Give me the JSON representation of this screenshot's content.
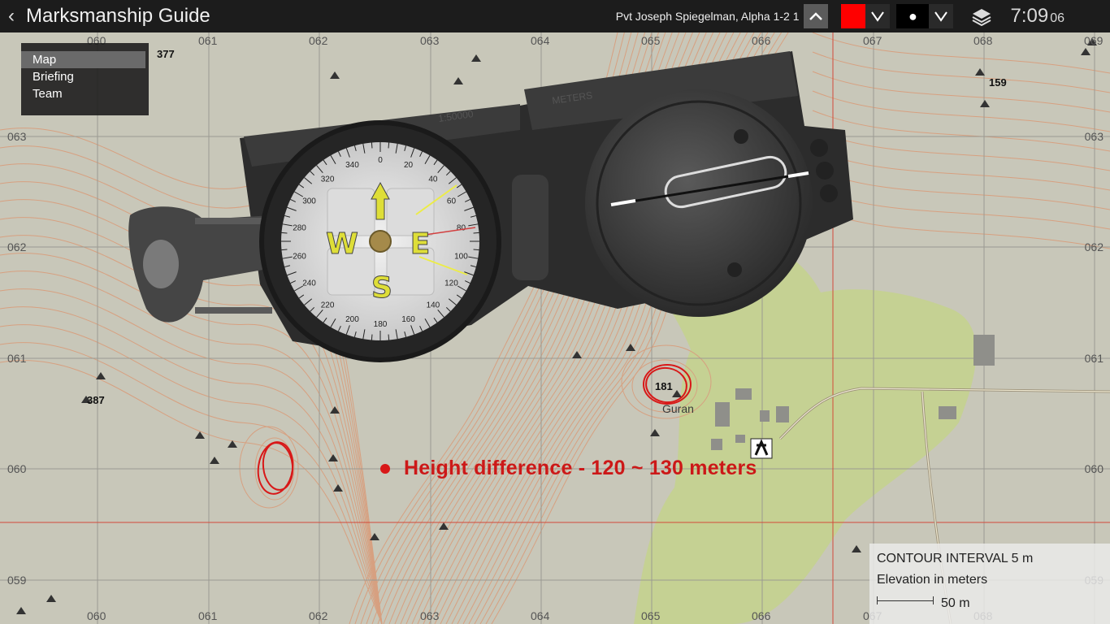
{
  "header": {
    "back_icon": "chevron-left-icon",
    "title": "Marksmanship Guide",
    "player": "Pvt Joseph Spiegelman, Alpha 1-2 1",
    "marker_color": "#ff0000",
    "marker_shape": "●",
    "layers_icon": "layers-icon",
    "time_hm": "7:09",
    "time_sec": "06"
  },
  "menu": {
    "items": [
      "Map",
      "Briefing",
      "Team"
    ],
    "active": "Map"
  },
  "map": {
    "grid_top": [
      "060",
      "061",
      "062",
      "063",
      "064",
      "065",
      "066",
      "067",
      "068",
      "069"
    ],
    "grid_bottom": [
      "060",
      "061",
      "062",
      "063",
      "064",
      "065",
      "066",
      "067",
      "068"
    ],
    "grid_left": [
      "063",
      "062",
      "061",
      "060",
      "059"
    ],
    "grid_right": [
      "063",
      "062",
      "061",
      "060",
      "059"
    ],
    "heights": [
      "377",
      "159",
      "387",
      "181"
    ],
    "town": "Guran",
    "annotation": "Height difference - 120 ~ 130 meters"
  },
  "compass": {
    "letters": [
      "W",
      "E",
      "S"
    ],
    "bezel_numbers": [
      "0",
      "20",
      "40",
      "60",
      "80",
      "100",
      "120",
      "140",
      "160",
      "180",
      "200",
      "220",
      "240",
      "260",
      "280",
      "300",
      "320",
      "340"
    ],
    "scale_text_a": "1:50000",
    "scale_text_b": "METERS"
  },
  "legend": {
    "line1": "CONTOUR INTERVAL 5 m",
    "line2": "Elevation in meters",
    "scale": "50 m"
  }
}
